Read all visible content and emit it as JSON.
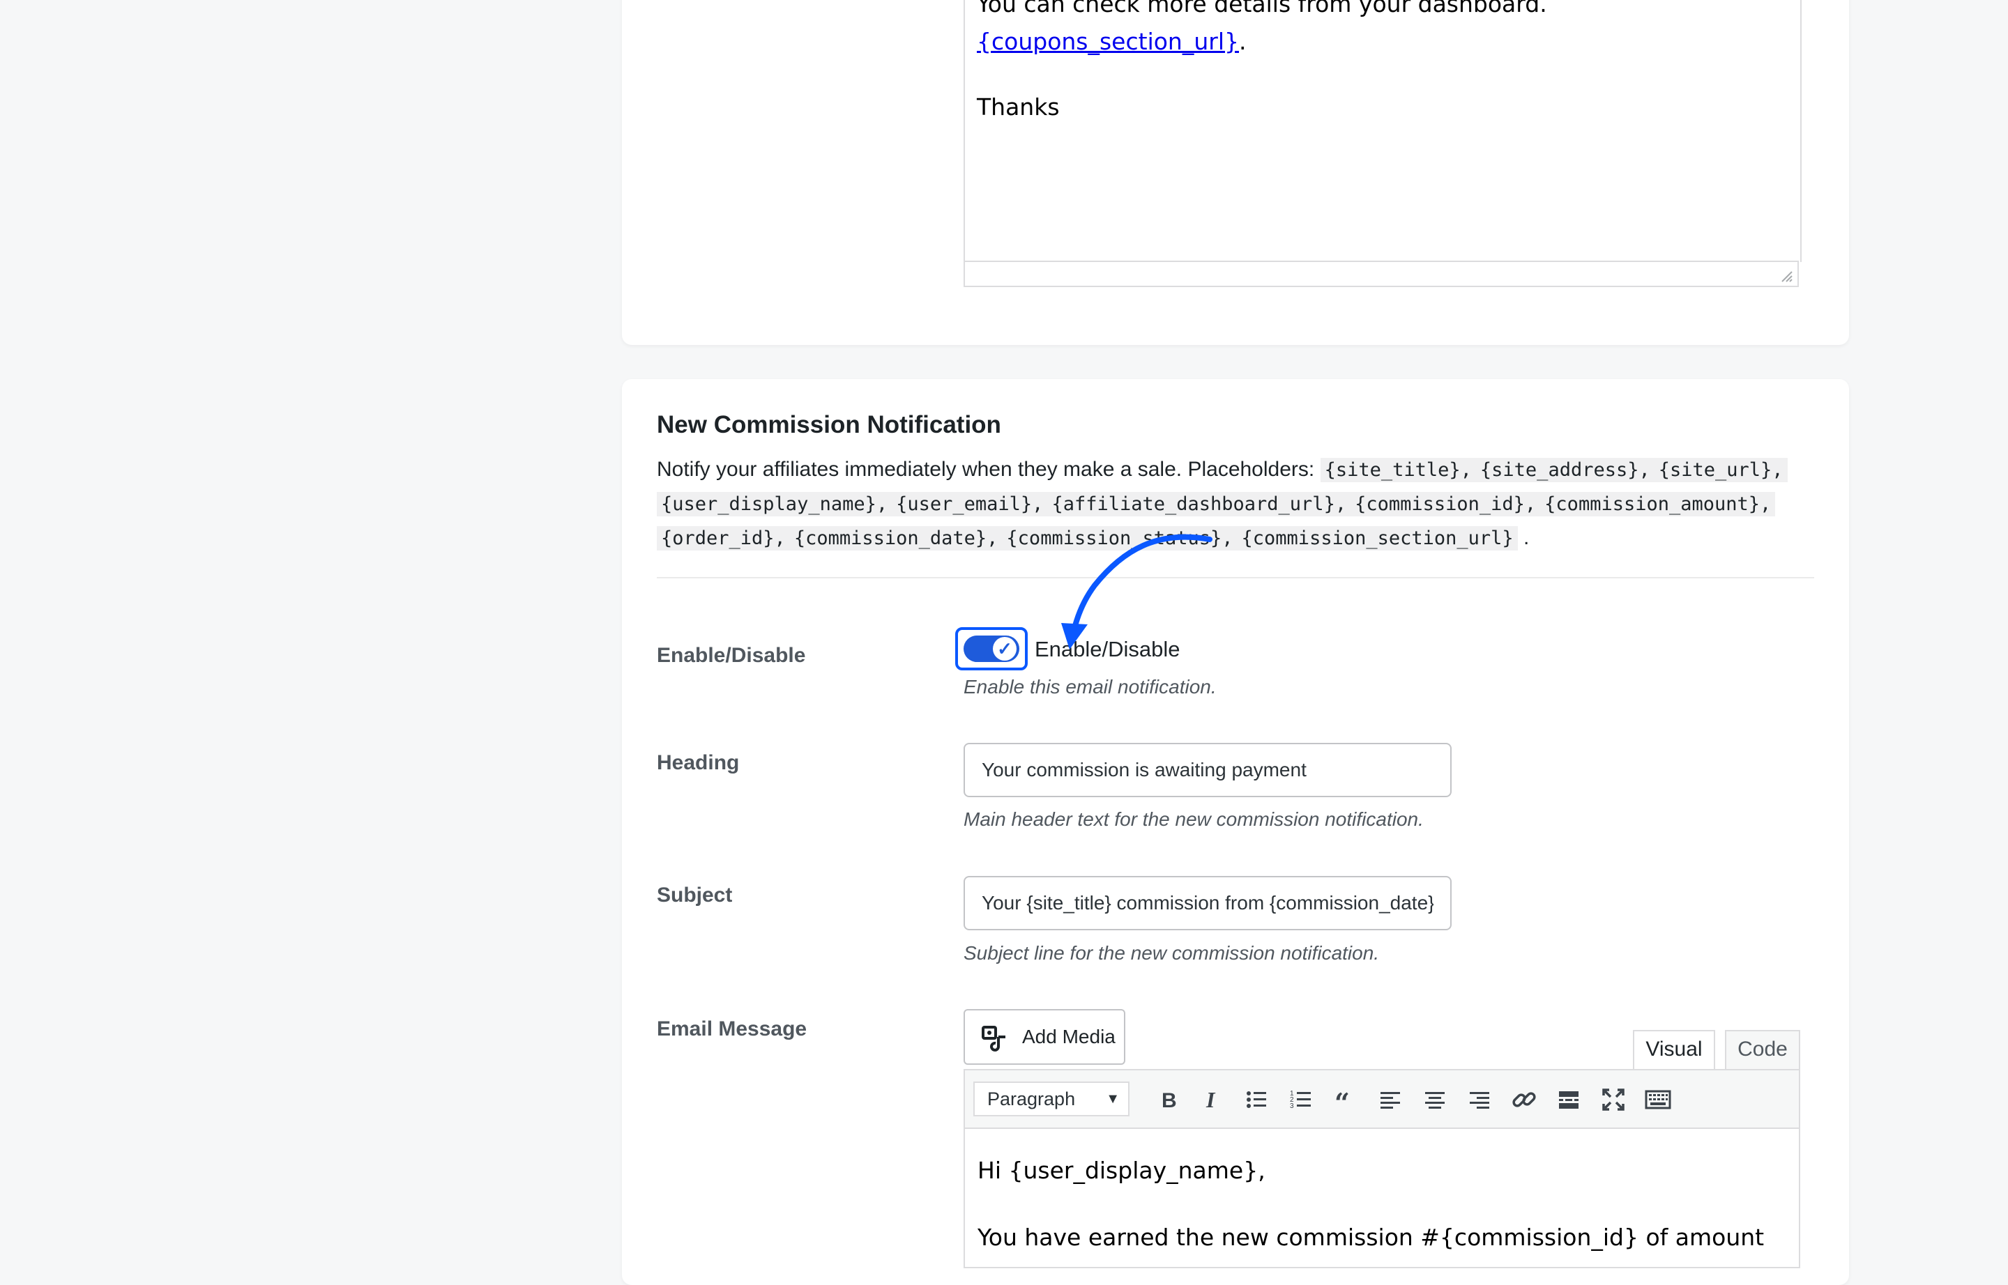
{
  "previous_section": {
    "editor_lines": [
      "You can check more details from your dashboard.",
      "Thanks"
    ],
    "link_text": "{coupons_section_url}",
    "link_suffix": "."
  },
  "section": {
    "title": "New Commission Notification",
    "description_prefix": "Notify your affiliates immediately when they make a sale. Placeholders:",
    "placeholders": [
      "{site_title},",
      "{site_address},",
      "{site_url},",
      "{user_display_name},",
      "{user_email},",
      "{affiliate_dashboard_url},",
      "{commission_id},",
      "{commission_amount},",
      "{order_id},",
      "{commission_date},",
      "{commission_status},",
      "{commission_section_url}"
    ],
    "description_suffix": "."
  },
  "fields": {
    "enable": {
      "label": "Enable/Disable",
      "checkbox_label": "Enable/Disable",
      "help": "Enable this email notification.",
      "checked": true,
      "check_glyph": "✓"
    },
    "heading": {
      "label": "Heading",
      "value": "Your commission is awaiting payment",
      "help": "Main header text for the new commission notification."
    },
    "subject": {
      "label": "Subject",
      "value": "Your {site_title} commission from {commission_date}",
      "help": "Subject line for the new commission notification."
    },
    "email_message": {
      "label": "Email Message",
      "add_media_label": "Add Media",
      "tabs": {
        "visual": "Visual",
        "code": "Code"
      },
      "format_select": "Paragraph",
      "toolbar_icons": [
        "bold-icon",
        "italic-icon",
        "bullet-list-icon",
        "numbered-list-icon",
        "blockquote-icon",
        "align-left-icon",
        "align-center-icon",
        "align-right-icon",
        "link-icon",
        "read-more-icon",
        "fullscreen-icon",
        "toolbar-toggle-icon"
      ],
      "body_lines": [
        "Hi {user_display_name},",
        "You have earned the new commission #{commission_id} of amount"
      ]
    }
  },
  "colors": {
    "accent": "#1e5bdb",
    "annotation_arrow": "#0a58ff",
    "link": "#0000ee"
  }
}
